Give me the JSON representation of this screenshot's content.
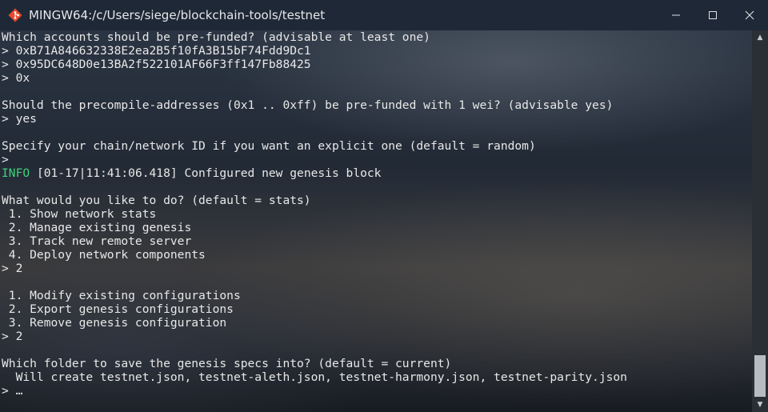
{
  "window": {
    "title": "MINGW64:/c/Users/siege/blockchain-tools/testnet",
    "controls": {
      "minimize": "minimize",
      "maximize": "maximize",
      "close": "close"
    },
    "icon": "git-bash-icon",
    "colors": {
      "info": "#3fd27a",
      "text": "#e8e8e8",
      "titlebar": "#1f2836"
    }
  },
  "terminal": {
    "lines": [
      {
        "text": "Which accounts should be pre-funded? (advisable at least one)"
      },
      {
        "text": "> 0xB71A846632338E2ea2B5f10fA3B15bF74Fdd9Dc1"
      },
      {
        "text": "> 0x95DC648D0e13BA2f522101AF66F3ff147Fb88425"
      },
      {
        "text": "> 0x"
      },
      {
        "text": ""
      },
      {
        "text": "Should the precompile-addresses (0x1 .. 0xff) be pre-funded with 1 wei? (advisable yes)"
      },
      {
        "text": "> yes"
      },
      {
        "text": ""
      },
      {
        "text": "Specify your chain/network ID if you want an explicit one (default = random)"
      },
      {
        "text": ">"
      },
      {
        "tag": "INFO",
        "text": " [01-17|11:41:06.418] Configured new genesis block"
      },
      {
        "text": ""
      },
      {
        "text": "What would you like to do? (default = stats)"
      },
      {
        "text": " 1. Show network stats"
      },
      {
        "text": " 2. Manage existing genesis"
      },
      {
        "text": " 3. Track new remote server"
      },
      {
        "text": " 4. Deploy network components"
      },
      {
        "text": "> 2"
      },
      {
        "text": ""
      },
      {
        "text": " 1. Modify existing configurations"
      },
      {
        "text": " 2. Export genesis configurations"
      },
      {
        "text": " 3. Remove genesis configuration"
      },
      {
        "text": "> 2"
      },
      {
        "text": ""
      },
      {
        "text": "Which folder to save the genesis specs into? (default = current)"
      },
      {
        "text": "  Will create testnet.json, testnet-aleth.json, testnet-harmony.json, testnet-parity.json"
      },
      {
        "text": "> …"
      }
    ]
  },
  "scrollbar": {
    "up": "▲",
    "down": "▼"
  }
}
